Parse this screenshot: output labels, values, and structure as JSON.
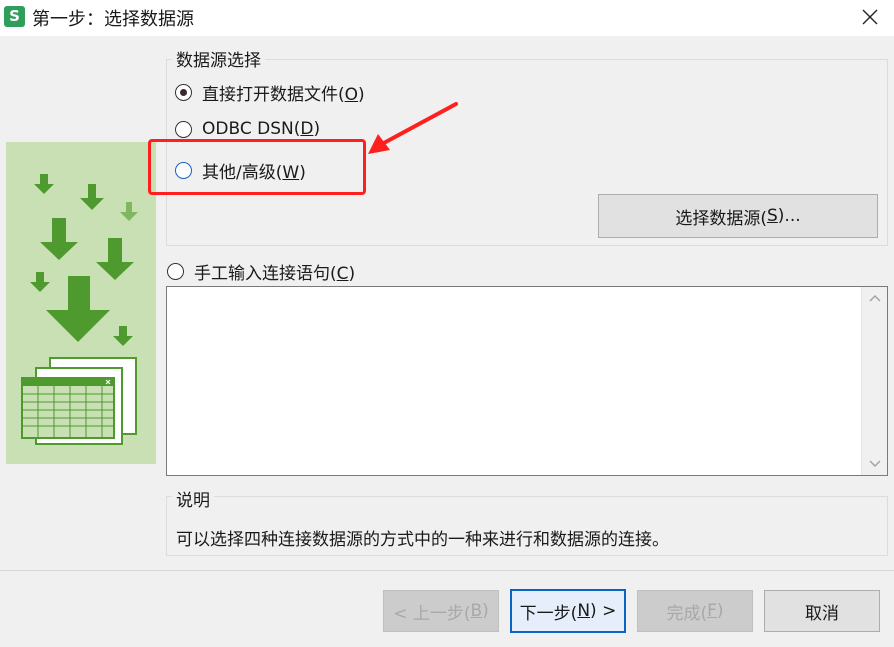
{
  "window": {
    "title": "第一步：选择数据源",
    "app_icon_letter": "S"
  },
  "datasource_group": {
    "label": "数据源选择",
    "options": [
      {
        "text": "直接打开数据文件(",
        "key": "O",
        "suffix": ")",
        "checked": true
      },
      {
        "text": "ODBC DSN(",
        "key": "D",
        "suffix": ")",
        "checked": false
      },
      {
        "text": "其他/高级(",
        "key": "W",
        "suffix": ")",
        "checked": false
      }
    ],
    "select_button": {
      "text": "选择数据源(",
      "key": "S",
      "suffix": ")..."
    }
  },
  "manual": {
    "text": "手工输入连接语句(",
    "key": "C",
    "suffix": ")",
    "checked": false,
    "value": ""
  },
  "description": {
    "label": "说明",
    "text": "可以选择四种连接数据源的方式中的一种来进行和数据源的连接。"
  },
  "footer": {
    "back": {
      "text": "< 上一步(",
      "key": "B",
      "suffix": ")",
      "disabled": true
    },
    "next": {
      "text": "下一步(",
      "key": "N",
      "suffix": ") >",
      "disabled": false
    },
    "finish": {
      "text": "完成(",
      "key": "F",
      "suffix": ")",
      "disabled": true
    },
    "cancel": {
      "text": "取消"
    }
  },
  "colors": {
    "annotation_red": "#ff1f1f",
    "illustration_bg": "#c8e0b4",
    "arrow_green_dark": "#4e9a2e",
    "arrow_green_light": "#7fb861"
  }
}
